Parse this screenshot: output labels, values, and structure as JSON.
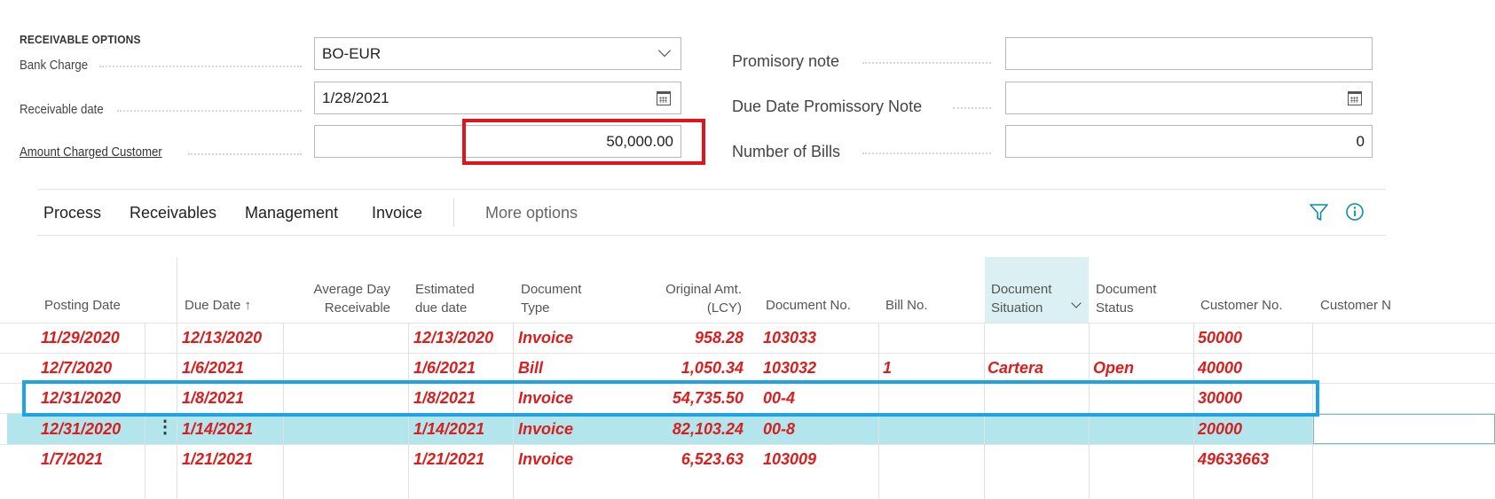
{
  "options": {
    "section_title": "RECEIVABLE OPTIONS",
    "bank_charge_label": "Bank Charge",
    "bank_charge_value": "BO-EUR",
    "receivable_date_label": "Receivable date",
    "receivable_date_value": "1/28/2021",
    "amount_charged_label": "Amount Charged Customer",
    "amount_charged_value": "50,000.00",
    "promissory_note_label": "Promisory note",
    "promissory_note_value": "",
    "due_date_promissory_label": "Due Date Promissory Note",
    "due_date_promissory_value": "",
    "number_of_bills_label": "Number of Bills",
    "number_of_bills_value": "0"
  },
  "actions": {
    "process": "Process",
    "receivables": "Receivables",
    "management": "Management",
    "invoice": "Invoice",
    "more_options": "More options"
  },
  "icons": {
    "filter": "filter-icon",
    "info": "info-icon",
    "calendar": "calendar-icon",
    "dropdown": "chevron-down-icon",
    "row_menu": "row-menu-icon"
  },
  "colors": {
    "row_text": "#d91e1e",
    "selected_row": "#b2e6ec",
    "highlight_red": "#e0141e",
    "highlight_blue": "#1ea3e6",
    "accent": "#00a1b0"
  },
  "table": {
    "headers": {
      "posting_date": "Posting Date",
      "due_date": "Due Date ↑",
      "avg_day_1": "Average Day",
      "avg_day_2": "Receivable",
      "est_due_1": "Estimated",
      "est_due_2": "due date",
      "doc_type_1": "Document",
      "doc_type_2": "Type",
      "orig_amt_1": "Original Amt.",
      "orig_amt_2": "(LCY)",
      "document_no": "Document No.",
      "bill_no": "Bill No.",
      "doc_situation_1": "Document",
      "doc_situation_2": "Situation",
      "doc_status_1": "Document",
      "doc_status_2": "Status",
      "customer_no": "Customer No.",
      "customer_name": "Customer N"
    },
    "rows": [
      {
        "posting_date": "11/29/2020",
        "due_date": "12/13/2020",
        "avg_day": "",
        "est_due": "12/13/2020",
        "doc_type": "Invoice",
        "orig_amt": "958.28",
        "document_no": "103033",
        "bill_no": "",
        "situation": "",
        "status": "",
        "customer_no": "50000"
      },
      {
        "posting_date": "12/7/2020",
        "due_date": "1/6/2021",
        "avg_day": "",
        "est_due": "1/6/2021",
        "doc_type": "Bill",
        "orig_amt": "1,050.34",
        "document_no": "103032",
        "bill_no": "1",
        "situation": "Cartera",
        "status": "Open",
        "customer_no": "40000"
      },
      {
        "posting_date": "12/31/2020",
        "due_date": "1/8/2021",
        "avg_day": "",
        "est_due": "1/8/2021",
        "doc_type": "Invoice",
        "orig_amt": "54,735.50",
        "document_no": "00-4",
        "bill_no": "",
        "situation": "",
        "status": "",
        "customer_no": "30000"
      },
      {
        "posting_date": "12/31/2020",
        "due_date": "1/14/2021",
        "avg_day": "",
        "est_due": "1/14/2021",
        "doc_type": "Invoice",
        "orig_amt": "82,103.24",
        "document_no": "00-8",
        "bill_no": "",
        "situation": "",
        "status": "",
        "customer_no": "20000"
      },
      {
        "posting_date": "1/7/2021",
        "due_date": "1/21/2021",
        "avg_day": "",
        "est_due": "1/21/2021",
        "doc_type": "Invoice",
        "orig_amt": "6,523.63",
        "document_no": "103009",
        "bill_no": "",
        "situation": "",
        "status": "",
        "customer_no": "49633663"
      }
    ]
  }
}
